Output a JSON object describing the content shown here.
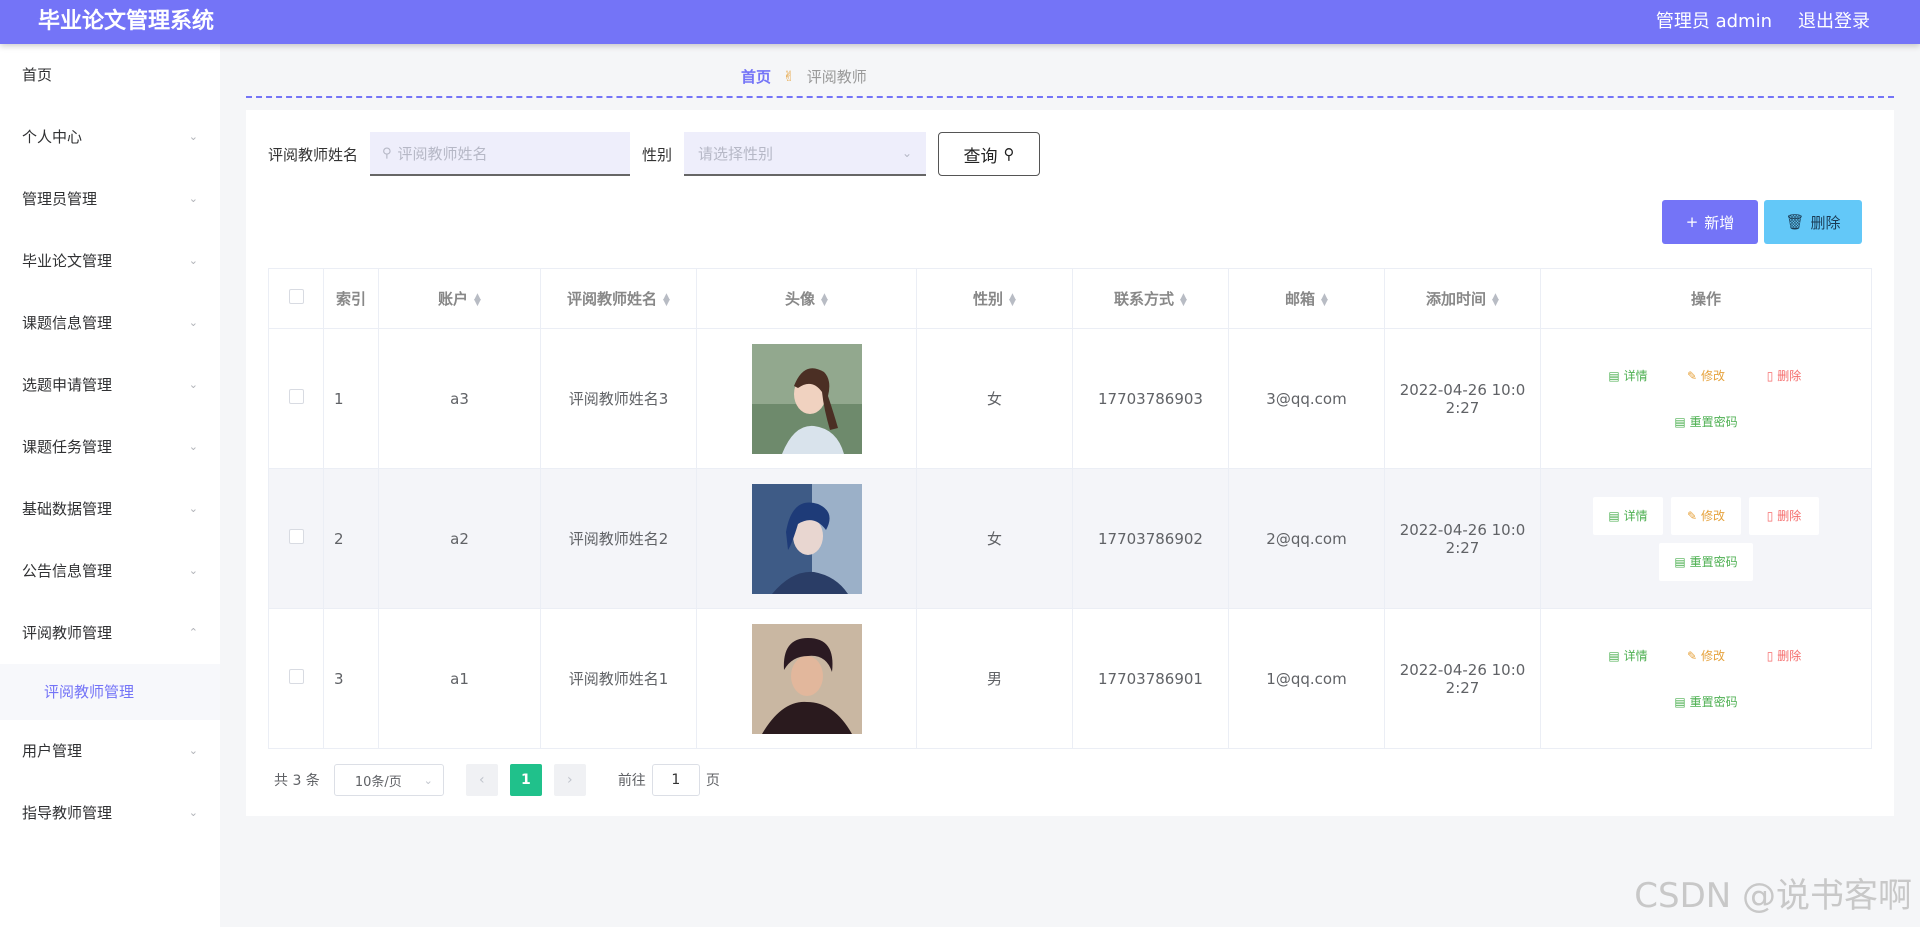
{
  "header": {
    "title": "毕业论文管理系统",
    "user_label": "管理员 admin",
    "logout_label": "退出登录"
  },
  "sidebar": {
    "items": [
      {
        "label": "首页"
      },
      {
        "label": "个人中心"
      },
      {
        "label": "管理员管理"
      },
      {
        "label": "毕业论文管理"
      },
      {
        "label": "课题信息管理"
      },
      {
        "label": "选题申请管理"
      },
      {
        "label": "课题任务管理"
      },
      {
        "label": "基础数据管理"
      },
      {
        "label": "公告信息管理"
      },
      {
        "label": "评阅教师管理"
      },
      {
        "label": "评阅教师管理"
      },
      {
        "label": "用户管理"
      },
      {
        "label": "指导教师管理"
      }
    ]
  },
  "breadcrumb": {
    "home": "首页",
    "current": "评阅教师"
  },
  "search": {
    "name_label": "评阅教师姓名",
    "name_placeholder": "评阅教师姓名",
    "gender_label": "性别",
    "gender_placeholder": "请选择性别",
    "query_label": "查询"
  },
  "actions": {
    "add_label": "新增",
    "delete_label": "删除"
  },
  "table": {
    "columns": [
      "索引",
      "账户",
      "评阅教师姓名",
      "头像",
      "性别",
      "联系方式",
      "邮箱",
      "添加时间",
      "操作"
    ],
    "rows": [
      {
        "index": "1",
        "account": "a3",
        "name": "评阅教师姓名3",
        "gender": "女",
        "phone": "17703786903",
        "email": "3@qq.com",
        "time_line1": "2022-04-26 10:0",
        "time_line2": "2:27"
      },
      {
        "index": "2",
        "account": "a2",
        "name": "评阅教师姓名2",
        "gender": "女",
        "phone": "17703786902",
        "email": "2@qq.com",
        "time_line1": "2022-04-26 10:0",
        "time_line2": "2:27"
      },
      {
        "index": "3",
        "account": "a1",
        "name": "评阅教师姓名1",
        "gender": "男",
        "phone": "17703786901",
        "email": "1@qq.com",
        "time_line1": "2022-04-26 10:0",
        "time_line2": "2:27"
      }
    ],
    "ops": {
      "detail": "详情",
      "edit": "修改",
      "remove": "删除",
      "reset": "重置密码"
    }
  },
  "pagination": {
    "total": "共 3 条",
    "page_size": "10条/页",
    "current_page": "1",
    "goto_label": "前往",
    "goto_value": "1",
    "page_suffix": "页"
  },
  "watermark": "CSDN @说书客啊",
  "colors": {
    "primary": "#7474f7",
    "accent_blue": "#63c8f8",
    "page_active": "#20c18b",
    "op_green": "#4caf50",
    "op_orange": "#e6a23c",
    "op_red": "#f56c6c"
  }
}
